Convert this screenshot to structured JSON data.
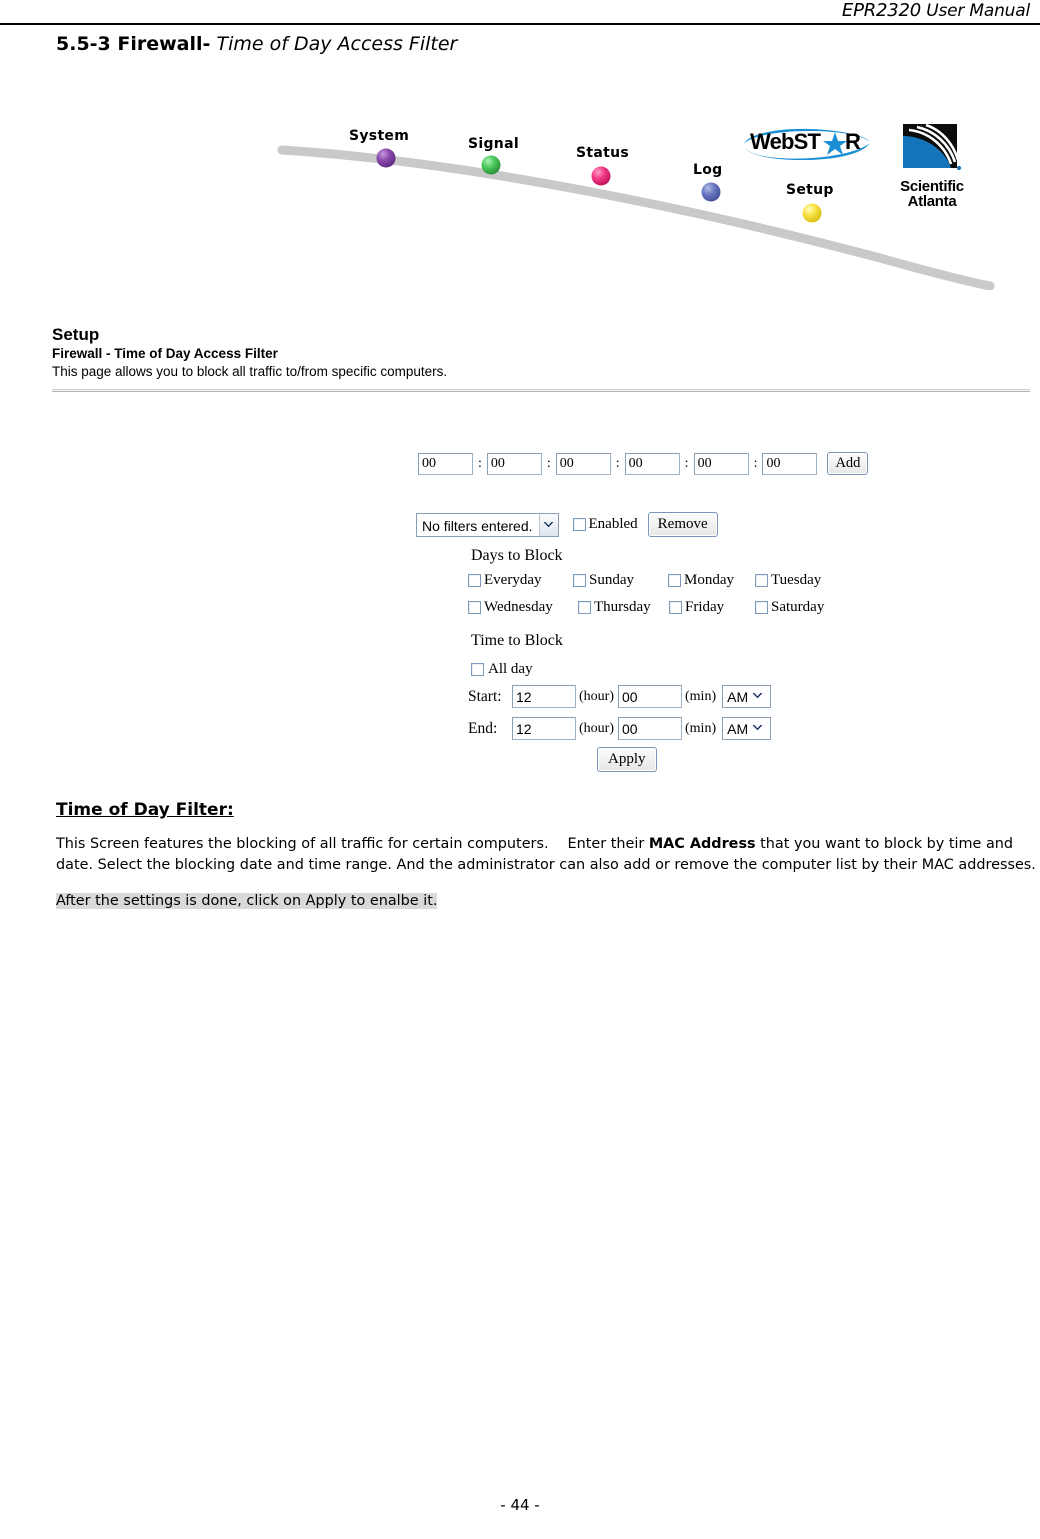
{
  "page_header": {
    "model": "EPR2320",
    "manual": "User Manual"
  },
  "section": {
    "number": "5.5-3 Firewall-",
    "subtitle": "Time of Day Access Filter"
  },
  "banner": {
    "nav_items": [
      {
        "label": "System",
        "color": "#7b3fa0"
      },
      {
        "label": "Signal",
        "color": "#3fbf4f"
      },
      {
        "label": "Status",
        "color": "#ee2c7b"
      },
      {
        "label": "Log",
        "color": "#5f6fb8"
      },
      {
        "label": "Setup",
        "color": "#f5e03a"
      }
    ],
    "brand_logo": "WebSTAR",
    "company_logo_line1": "Scientific",
    "company_logo_line2": "Atlanta",
    "curve_color": "#c9c9c9"
  },
  "setup": {
    "title": "Setup",
    "subtitle": "Firewall - Time of Day Access Filter",
    "description": "This page allows you to block all traffic to/from specific computers."
  },
  "form": {
    "mac_octets": [
      "00",
      "00",
      "00",
      "00",
      "00",
      "00"
    ],
    "mac_separator": ":",
    "add_button": "Add",
    "filter_select_value": "No filters entered.",
    "enabled_label": "Enabled",
    "enabled_checked": false,
    "remove_button": "Remove",
    "days_group_title": "Days to Block",
    "days": [
      {
        "label": "Everyday",
        "checked": false
      },
      {
        "label": "Sunday",
        "checked": false
      },
      {
        "label": "Monday",
        "checked": false
      },
      {
        "label": "Tuesday",
        "checked": false
      },
      {
        "label": "Wednesday",
        "checked": false
      },
      {
        "label": "Thursday",
        "checked": false
      },
      {
        "label": "Friday",
        "checked": false
      },
      {
        "label": "Saturday",
        "checked": false
      }
    ],
    "time_group_title": "Time to Block",
    "all_day_label": "All day",
    "all_day_checked": false,
    "start_label": "Start:",
    "start_hour": "12",
    "start_min": "00",
    "start_ampm": "AM",
    "end_label": "End:",
    "end_hour": "12",
    "end_min": "00",
    "end_ampm": "AM",
    "hour_unit": "(hour)",
    "min_unit": "(min)",
    "apply_button": "Apply"
  },
  "explanation": {
    "heading": "Time of Day Filter:",
    "body_part1": "This Screen features the blocking of all traffic for certain computers.  Enter their ",
    "body_bold": "MAC Address",
    "body_part2": " that you want to block by time and date. Select the blocking date and time range. And the administrator can also add or remove the computer list by their MAC addresses.",
    "note": "After the settings is done, click on Apply to enalbe it."
  },
  "footer": {
    "page_number": "- 44 -"
  }
}
